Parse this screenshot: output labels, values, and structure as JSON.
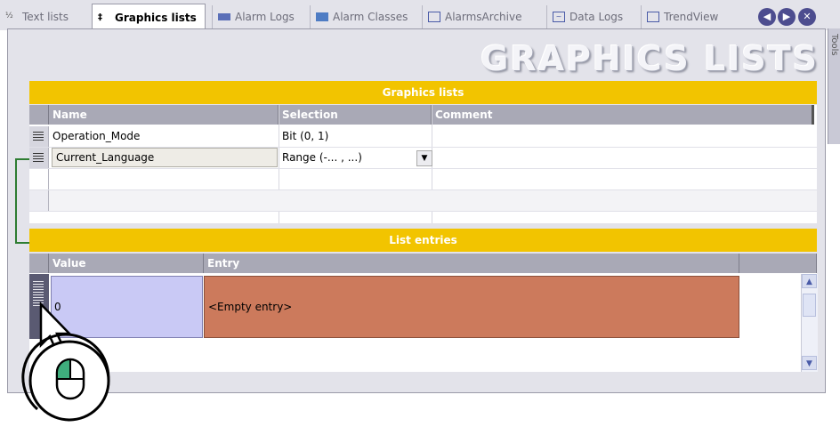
{
  "tabs": [
    {
      "label": "Text lists",
      "icon": "text-lists-icon",
      "active": false
    },
    {
      "label": "Graphics lists",
      "icon": "graphics-lists-icon",
      "active": true
    },
    {
      "label": "Alarm Logs",
      "icon": "alarm-logs-icon",
      "active": false
    },
    {
      "label": "Alarm Classes",
      "icon": "alarm-classes-icon",
      "active": false
    },
    {
      "label": "AlarmsArchive",
      "icon": "window-icon",
      "active": false
    },
    {
      "label": "Data Logs",
      "icon": "data-logs-icon",
      "active": false
    },
    {
      "label": "TrendView",
      "icon": "window-icon",
      "active": false
    }
  ],
  "nav": {
    "prev": "◀",
    "next": "▶",
    "close": "✕"
  },
  "side_label": "Tools",
  "page_title": "GRAPHICS LISTS",
  "graphics_lists": {
    "section_title": "Graphics lists",
    "columns": [
      "Name",
      "Selection",
      "Comment"
    ],
    "rows": [
      {
        "name": "Operation_Mode",
        "selection": "Bit (0, 1)",
        "comment": ""
      },
      {
        "name": "Current_Language",
        "selection": "Range (-... , ...)",
        "comment": ""
      }
    ]
  },
  "list_entries": {
    "section_title": "List entries",
    "columns": [
      "Value",
      "Entry"
    ],
    "rows": [
      {
        "value": "0",
        "entry": "<Empty entry>"
      }
    ]
  },
  "colors": {
    "section_bar": "#f2c400",
    "value_selected": "#c9c9f5",
    "entry_selected": "#cc7a5c",
    "bracket": "#2e7d32"
  }
}
